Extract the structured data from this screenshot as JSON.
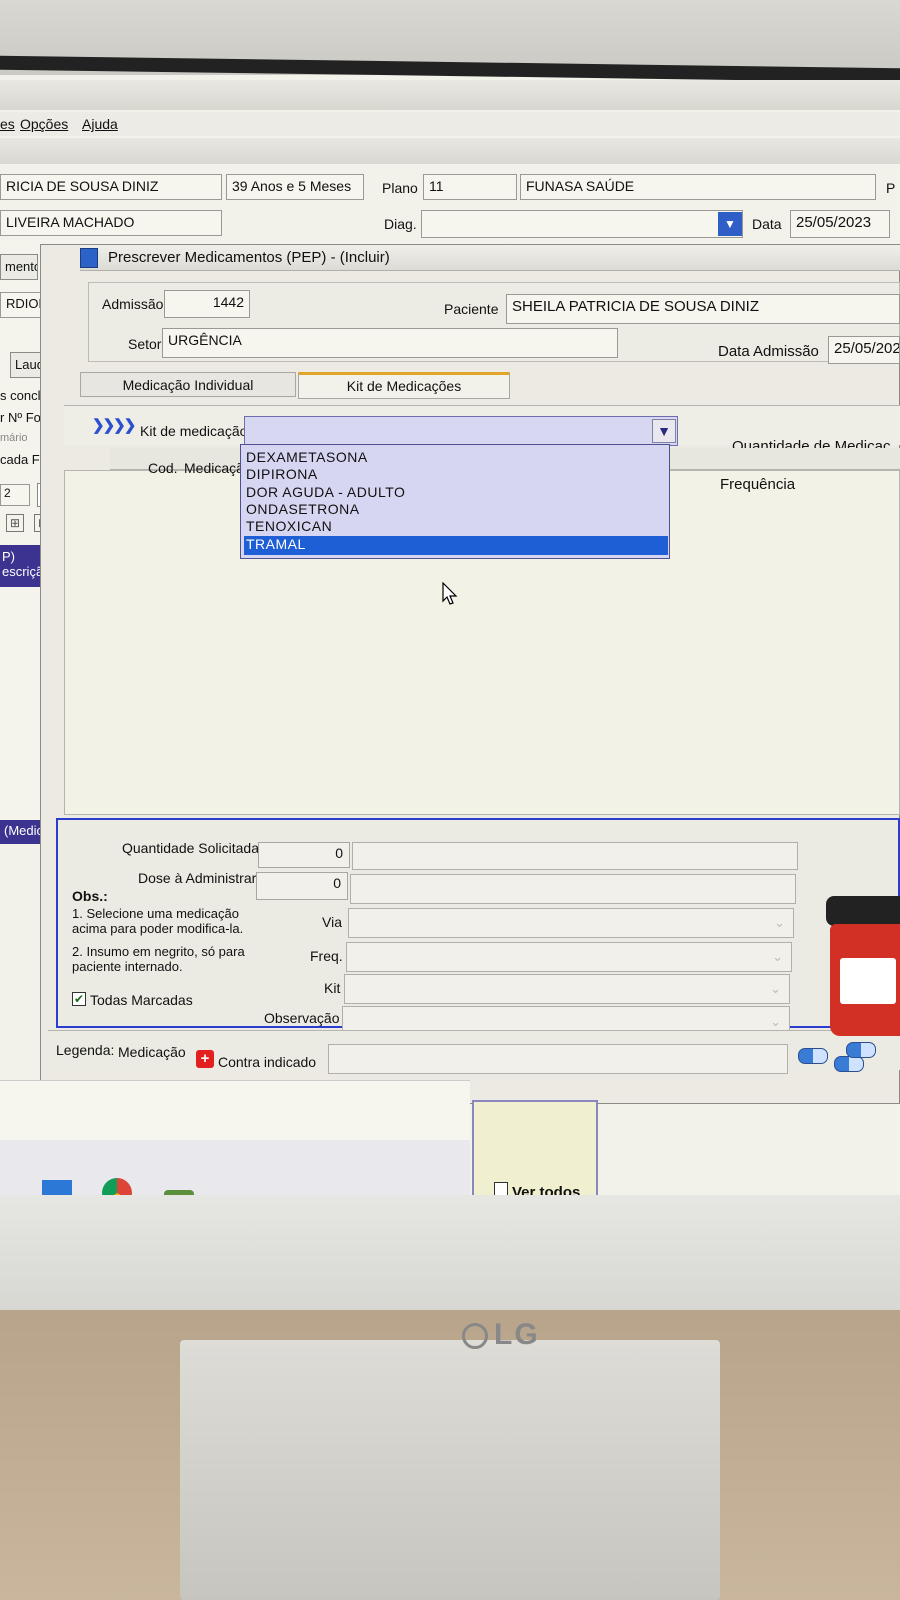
{
  "menu": {
    "items": [
      "es",
      "Opções",
      "Ajuda"
    ]
  },
  "header": {
    "patient_name_partial": "RICIA DE SOUSA DINIZ",
    "age": "39 Anos e 5 Meses",
    "plano_label": "Plano",
    "plano_code": "11",
    "plano_name": "FUNASA SAÚDE",
    "plano_extra": "P",
    "doctor_partial": "LIVEIRA MACHADO",
    "diag_label": "Diag.",
    "diag_value": "",
    "data_label": "Data",
    "data_value": "25/05/2023"
  },
  "left_panel": {
    "tab1": "mento",
    "tab_icon": "folder-icon",
    "dept": "RDIOLOGIA",
    "laudos": "Laudos (#",
    "line1": "s conclusão",
    "line2": "r Nº Folha",
    "line3": "mário",
    "line4": "cada Folha",
    "zoom": "2",
    "purple1": "P)",
    "purple2": "escrição (C",
    "purple3": "(Medic"
  },
  "dialog": {
    "title": "Prescrever Medicamentos (PEP) -  (Incluir)",
    "admissao_label": "Admissão",
    "admissao_value": "1442",
    "paciente_label": "Paciente",
    "paciente_value": "SHEILA PATRICIA DE SOUSA DINIZ",
    "setor_label": "Setor",
    "setor_value": "URGÊNCIA",
    "data_admissao_label": "Data Admissão",
    "data_admissao_value": "25/05/202",
    "tabs": [
      "Medicação Individual",
      "Kit de Medicações"
    ],
    "kit_label": "Kit de medicação",
    "kit_value": "",
    "quantidade_label": "Quantidade de Medicaç",
    "columns": [
      "Cod.",
      "Medicação",
      "Frequência"
    ],
    "kit_options": [
      "DEXAMETASONA",
      "DIPIRONA",
      "DOR AGUDA - ADULTO",
      "ONDASETRONA",
      "TENOXICAN",
      "TRAMAL"
    ],
    "kit_selected": "TRAMAL"
  },
  "bottom": {
    "qtd_solicitada_label": "Quantidade Solicitada",
    "qtd_solicitada_value": "0",
    "dose_label": "Dose à Administrar",
    "dose_value": "0",
    "obs_title": "Obs.:",
    "obs1": "1. Selecione uma medicação acima para poder modifica-la.",
    "obs2": "2. Insumo em negrito, só para paciente internado.",
    "via_label": "Via",
    "freq_label": "Freq.",
    "kit_label": "Kit",
    "observacao_label": "Observação",
    "todas_marcadas_label": "Todas Marcadas",
    "todas_marcadas_checked": true
  },
  "legend": {
    "label": "Legenda:",
    "item1": "Medicação",
    "item2": "Contra indicado"
  },
  "lower": {
    "ver_todos_label": "Ver todos"
  },
  "monitor": {
    "brand": "LG"
  },
  "colors": {
    "selection": "#1e5fd6",
    "panel_border": "#2c3bd0",
    "dropdown_bg": "#d7d6f2",
    "tab_accent": "#e1a52a"
  }
}
